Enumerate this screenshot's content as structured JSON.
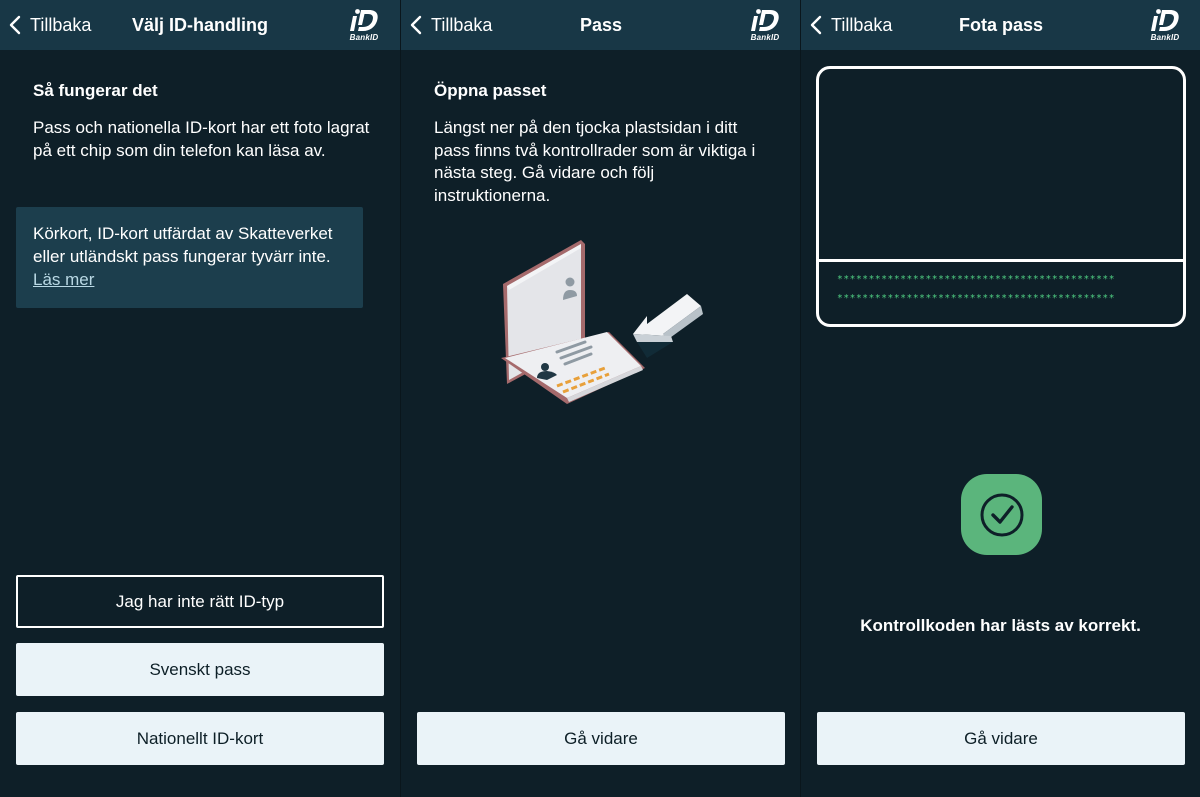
{
  "screen1": {
    "nav": {
      "back_label": "Tillbaka",
      "title": "Välj ID-handling",
      "logo_text": "BankID"
    },
    "heading": "Så fungerar det",
    "paragraph": "Pass och nationella ID-kort har ett foto lagrat på ett chip som din telefon kan läsa av.",
    "info_text": "Körkort, ID-kort utfärdat av Skatteverket eller utländskt pass fungerar tyvärr inte.",
    "info_link": "Läs mer",
    "buttons": {
      "wrong_id": "Jag har inte rätt ID-typ",
      "swedish_passport": "Svenskt pass",
      "national_id": "Nationellt ID-kort"
    }
  },
  "screen2": {
    "nav": {
      "back_label": "Tillbaka",
      "title": "Pass",
      "logo_text": "BankID"
    },
    "heading": "Öppna passet",
    "paragraph": "Längst ner på den tjocka plastsidan i ditt pass finns två kontrollrader som är viktiga i nästa steg. Gå vidare och följ instruktionerna.",
    "continue_label": "Gå vidare"
  },
  "screen3": {
    "nav": {
      "back_label": "Tillbaka",
      "title": "Fota pass",
      "logo_text": "BankID"
    },
    "mrz_lines": [
      "********************************************",
      "********************************************"
    ],
    "status_text": "Kontrollkoden har lästs av korrekt.",
    "continue_label": "Gå vidare"
  },
  "colors": {
    "background": "#0e1f28",
    "navbar": "#183746",
    "infobox": "#1c3e4d",
    "button_light": "#eaf3f8",
    "success_green": "#5bb57c",
    "mrz_green": "#4fce82",
    "highlight_orange": "#e8a03a"
  },
  "icons": {
    "back": "chevron-left-icon",
    "logo": "bankid-logo-icon",
    "check": "checkmark-circle-icon",
    "illustration": "open-passport-illustration"
  }
}
